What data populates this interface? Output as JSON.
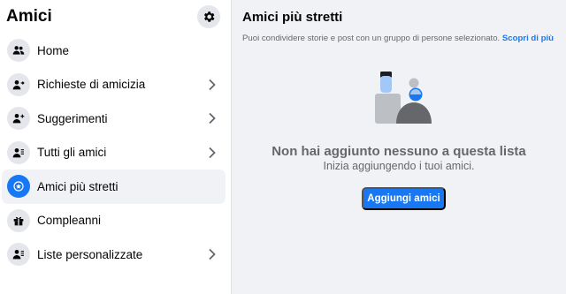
{
  "sidebar": {
    "title": "Amici",
    "settings_icon": "gear-icon",
    "items": [
      {
        "label": "Home",
        "icon": "friends-icon",
        "chevron": false,
        "active": false
      },
      {
        "label": "Richieste di amicizia",
        "icon": "person-arrow-icon",
        "chevron": true,
        "active": false
      },
      {
        "label": "Suggerimenti",
        "icon": "person-plus-icon",
        "chevron": true,
        "active": false
      },
      {
        "label": "Tutti gli amici",
        "icon": "person-list-icon",
        "chevron": true,
        "active": false
      },
      {
        "label": "Amici più stretti",
        "icon": "star-icon",
        "chevron": false,
        "active": true
      },
      {
        "label": "Compleanni",
        "icon": "gift-icon",
        "chevron": false,
        "active": false
      },
      {
        "label": "Liste personalizzate",
        "icon": "person-list-icon",
        "chevron": true,
        "active": false
      }
    ]
  },
  "main": {
    "title": "Amici più stretti",
    "description": "Puoi condividere storie e post con un gruppo di persone selezionato.",
    "learn_more": "Scopri di più",
    "empty_title": "Non hai aggiunto nessuno a questa lista",
    "empty_subtitle": "Inizia aggiungendo i tuoi amici.",
    "add_button": "Aggiungi amici"
  },
  "colors": {
    "accent": "#1877f2",
    "background": "#f0f2f5",
    "icon_bg": "#e4e6eb"
  }
}
